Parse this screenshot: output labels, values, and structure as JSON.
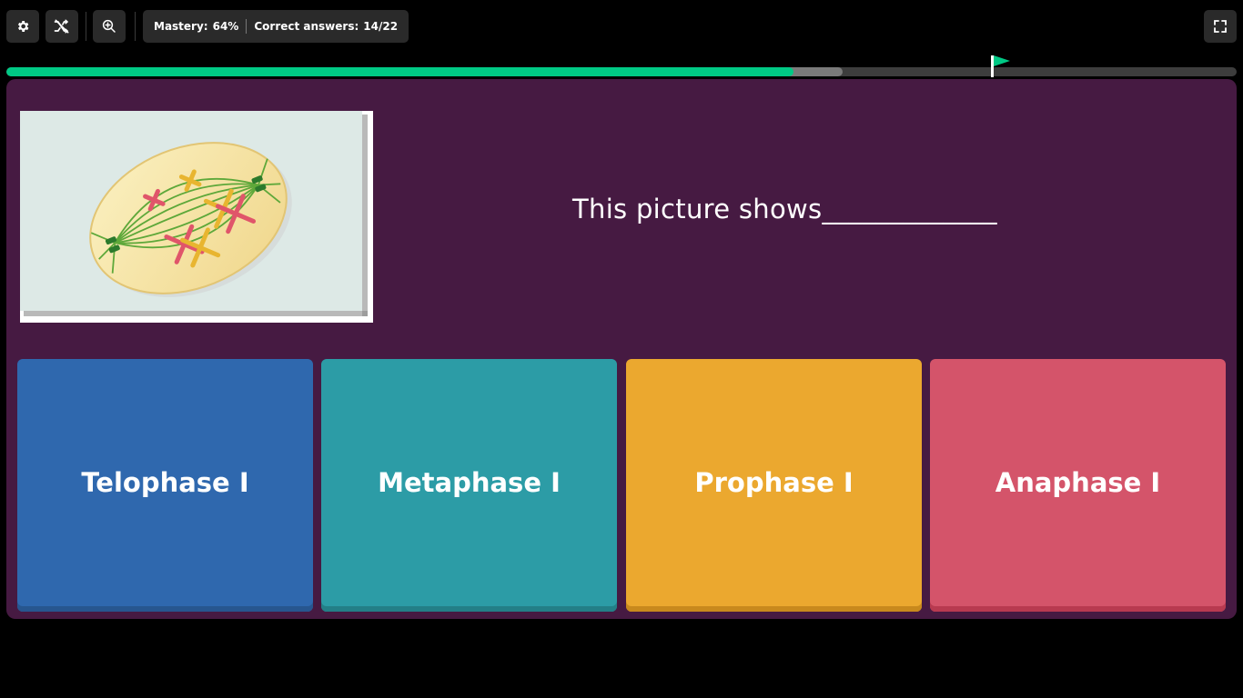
{
  "toolbar": {
    "settings_icon": "gear-icon",
    "powerups_icon": "shuffle-off-icon",
    "zoom_icon": "zoom-in-icon",
    "fullscreen_icon": "fullscreen-icon"
  },
  "stats": {
    "mastery_label": "Mastery:",
    "mastery_value": "64%",
    "correct_label": "Correct answers:",
    "correct_value": "14/22"
  },
  "progress": {
    "correct_fraction": 0.64,
    "attempted_fraction": 0.68,
    "flag_fraction": 0.8,
    "fill_color": "#00c985",
    "attempted_color": "#7a7a7a",
    "track_color": "#3d3d3d"
  },
  "question": {
    "text": "This picture shows_____________",
    "image_icon": "cell-division-illustration"
  },
  "options": [
    {
      "label": "Telophase I",
      "color": "#2f68ae",
      "shade": "#27568f"
    },
    {
      "label": "Metaphase I",
      "color": "#2c9ca6",
      "shade": "#237f87"
    },
    {
      "label": "Prophase I",
      "color": "#eba82f",
      "shade": "#c8891d"
    },
    {
      "label": "Anaphase I",
      "color": "#d4546a",
      "shade": "#b83a50"
    }
  ],
  "colors": {
    "background": "#000000",
    "card": "#461a42",
    "toolbar_button": "#2a2a2a"
  }
}
